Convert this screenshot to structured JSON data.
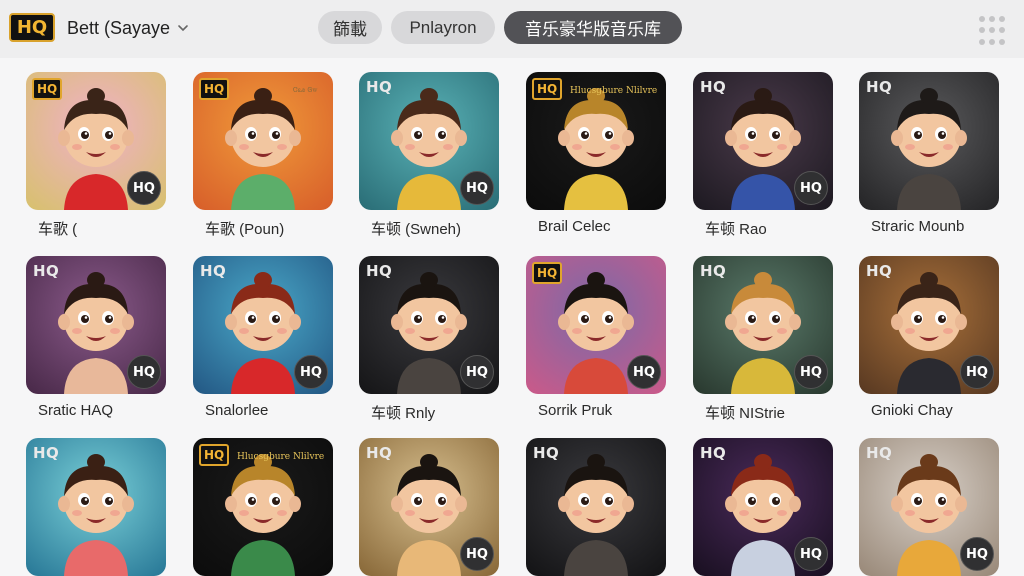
{
  "header": {
    "logo_text": "HQ",
    "account_label": "Bett (Sayaye",
    "tabs": [
      {
        "label": "篩載",
        "active": false
      },
      {
        "label": "Pnlayron",
        "active": false
      },
      {
        "label": "音乐豪华版音乐库",
        "active": true
      }
    ]
  },
  "icons": {
    "account_chevron": "chevron-down-icon",
    "apps_menu": "grid-dots-icon"
  },
  "colors": {
    "accent_gold": "#e0a52c",
    "active_tab": "#525256"
  },
  "cards": [
    {
      "caption": "车歌 (",
      "corner_badge": "HQ",
      "corner_style": "gold",
      "badge": "HQ",
      "scribble": "",
      "bg": [
        "#f0b0c8",
        "#d8c070"
      ],
      "hair": "#3a2418",
      "shirt": "#d8282a"
    },
    {
      "caption": "车歌 (Poun)",
      "corner_badge": "HQ",
      "corner_style": "gold",
      "badge": "",
      "scribble": "",
      "small_scribble": "Ꮳꮛꮚ Ꮆꮃ",
      "bg": [
        "#f09a3a",
        "#d8602a"
      ],
      "hair": "#3a2014",
      "shirt": "#5cae6a"
    },
    {
      "caption": "车顿 (Swneh)",
      "corner_badge": "HQ",
      "corner_style": "plain",
      "badge": "HQ",
      "scribble": "",
      "bg": [
        "#5ab2b6",
        "#2b6f78"
      ],
      "hair": "#4a2a1a",
      "shirt": "#e6b93a"
    },
    {
      "caption": "Brail Celec",
      "corner_badge": "HQ",
      "corner_style": "gold",
      "badge": "",
      "scribble": "Hlucsgbure Nlilvre",
      "bg": [
        "#1a1a1a",
        "#0c0c0c"
      ],
      "hair": "#b8852a",
      "shirt": "#e5c040"
    },
    {
      "caption": "车顿 Rao",
      "corner_badge": "HQ",
      "corner_style": "plain",
      "badge": "HQ",
      "scribble": "",
      "bg": [
        "#4a3a4a",
        "#1e1a22"
      ],
      "hair": "#2a1a14",
      "shirt": "#3554a8"
    },
    {
      "caption": "Straric Mounb",
      "corner_badge": "HQ",
      "corner_style": "plain",
      "badge": "",
      "scribble": "",
      "bg": [
        "#5a5a5c",
        "#262628"
      ],
      "hair": "#1e1a18",
      "shirt": "#4a4440"
    },
    {
      "caption": "Sratic HAQ",
      "corner_badge": "HQ",
      "corner_style": "plain",
      "badge": "HQ",
      "scribble": "",
      "bg": [
        "#8a5a8a",
        "#4a2a4a"
      ],
      "hair": "#2a1a14",
      "shirt": "#e8b89a"
    },
    {
      "caption": "Snalorlee",
      "corner_badge": "HQ",
      "corner_style": "plain",
      "badge": "HQ",
      "scribble": "",
      "bg": [
        "#4aa8c8",
        "#245a86"
      ],
      "hair": "#8a2a18",
      "shirt": "#d8282a"
    },
    {
      "caption": "车顿 Rnly",
      "corner_badge": "HQ",
      "corner_style": "plain",
      "badge": "HQ",
      "scribble": "",
      "bg": [
        "#3a3a3e",
        "#161618"
      ],
      "hair": "#1a1410",
      "shirt": "#4a4440"
    },
    {
      "caption": "Sorrik Pruk",
      "corner_badge": "HQ",
      "corner_style": "gold",
      "badge": "HQ",
      "scribble": "",
      "bg": [
        "#7a6aa8",
        "#c85a8a"
      ],
      "hair": "#1a1410",
      "shirt": "#d84a3a"
    },
    {
      "caption": "车顿 NIStrie",
      "corner_badge": "HQ",
      "corner_style": "plain",
      "badge": "HQ",
      "scribble": "",
      "bg": [
        "#5a7a6a",
        "#2a3a30"
      ],
      "hair": "#c88a3a",
      "shirt": "#d8b83a"
    },
    {
      "caption": "Gnioki Chay",
      "corner_badge": "HQ",
      "corner_style": "plain",
      "badge": "HQ",
      "scribble": "",
      "bg": [
        "#a8703a",
        "#5a3a22"
      ],
      "hair": "#3a2418",
      "shirt": "#2a2a30"
    },
    {
      "caption": "",
      "corner_badge": "HQ",
      "corner_style": "plain",
      "badge": "",
      "scribble": "",
      "bg": [
        "#7ad0d8",
        "#2a7a98"
      ],
      "hair": "#3a2014",
      "shirt": "#e86a6a"
    },
    {
      "caption": "",
      "corner_badge": "HQ",
      "corner_style": "gold",
      "badge": "",
      "scribble": "Hlucsgbure Nlilvre",
      "bg": [
        "#1a1a1a",
        "#0c0c0c"
      ],
      "hair": "#b8852a",
      "shirt": "#3a8a4a"
    },
    {
      "caption": "",
      "corner_badge": "HQ",
      "corner_style": "plain",
      "badge": "HQ",
      "scribble": "",
      "bg": [
        "#d8c090",
        "#8a6a3a"
      ],
      "hair": "#1a1410",
      "shirt": "#e8b878"
    },
    {
      "caption": "",
      "corner_badge": "HQ",
      "corner_style": "plain",
      "badge": "",
      "scribble": "",
      "bg": [
        "#3a3a3e",
        "#141416"
      ],
      "hair": "#1a1410",
      "shirt": "#4a4440"
    },
    {
      "caption": "",
      "corner_badge": "HQ",
      "corner_style": "plain",
      "badge": "HQ",
      "scribble": "",
      "bg": [
        "#4a2a5a",
        "#1a1022"
      ],
      "hair": "#8a2a18",
      "shirt": "#c8d0e0"
    },
    {
      "caption": "",
      "corner_badge": "HQ",
      "corner_style": "plain",
      "badge": "HQ",
      "scribble": "",
      "bg": [
        "#d8d0c8",
        "#9a8a7a"
      ],
      "hair": "#6a3a1a",
      "shirt": "#e8a83a"
    }
  ]
}
